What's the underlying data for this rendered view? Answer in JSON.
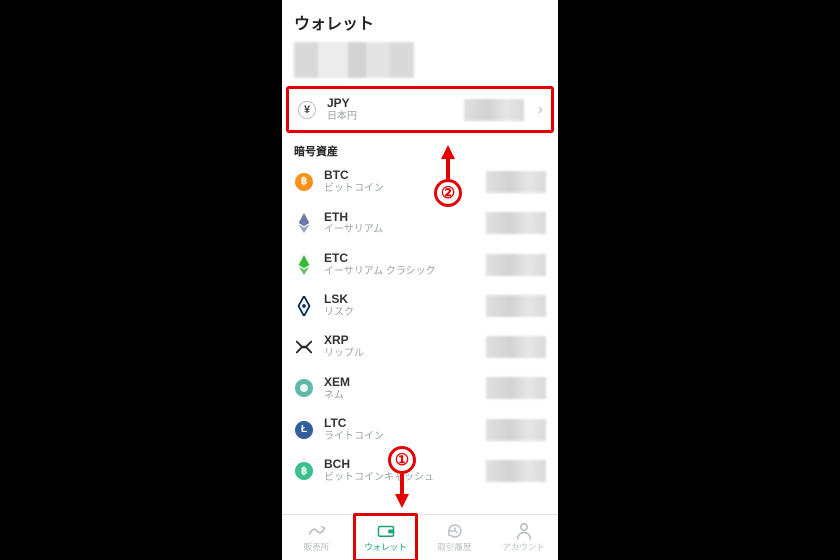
{
  "header": {
    "title": "ウォレット"
  },
  "fiat": {
    "symbol": "JPY",
    "name": "日本円",
    "icon_name": "yen-icon"
  },
  "section_label": "暗号資産",
  "assets": [
    {
      "symbol": "BTC",
      "name": "ビットコイン",
      "icon": "btc",
      "color": "#f7931a"
    },
    {
      "symbol": "ETH",
      "name": "イーサリアム",
      "icon": "eth",
      "color": "#6a7aa5"
    },
    {
      "symbol": "ETC",
      "name": "イーサリアム クラシック",
      "icon": "etc",
      "color": "#3ab83a"
    },
    {
      "symbol": "LSK",
      "name": "リスク",
      "icon": "lsk",
      "color": "#0b2a52"
    },
    {
      "symbol": "XRP",
      "name": "リップル",
      "icon": "xrp",
      "color": "#222"
    },
    {
      "symbol": "XEM",
      "name": "ネム",
      "icon": "xem",
      "color": "#5fb9a6"
    },
    {
      "symbol": "LTC",
      "name": "ライトコイン",
      "icon": "ltc",
      "color": "#345d9d"
    },
    {
      "symbol": "BCH",
      "name": "ビットコインキャッシュ",
      "icon": "bch",
      "color": "#3cc18e"
    }
  ],
  "nav": {
    "items": [
      {
        "id": "exchange",
        "label": "販売所",
        "icon": "trend-icon"
      },
      {
        "id": "wallet",
        "label": "ウォレット",
        "icon": "wallet-icon",
        "active": true
      },
      {
        "id": "history",
        "label": "取引履歴",
        "icon": "history-icon"
      },
      {
        "id": "account",
        "label": "アカウント",
        "icon": "account-icon"
      }
    ]
  },
  "annotations": {
    "callout1": "①",
    "callout2": "②"
  }
}
